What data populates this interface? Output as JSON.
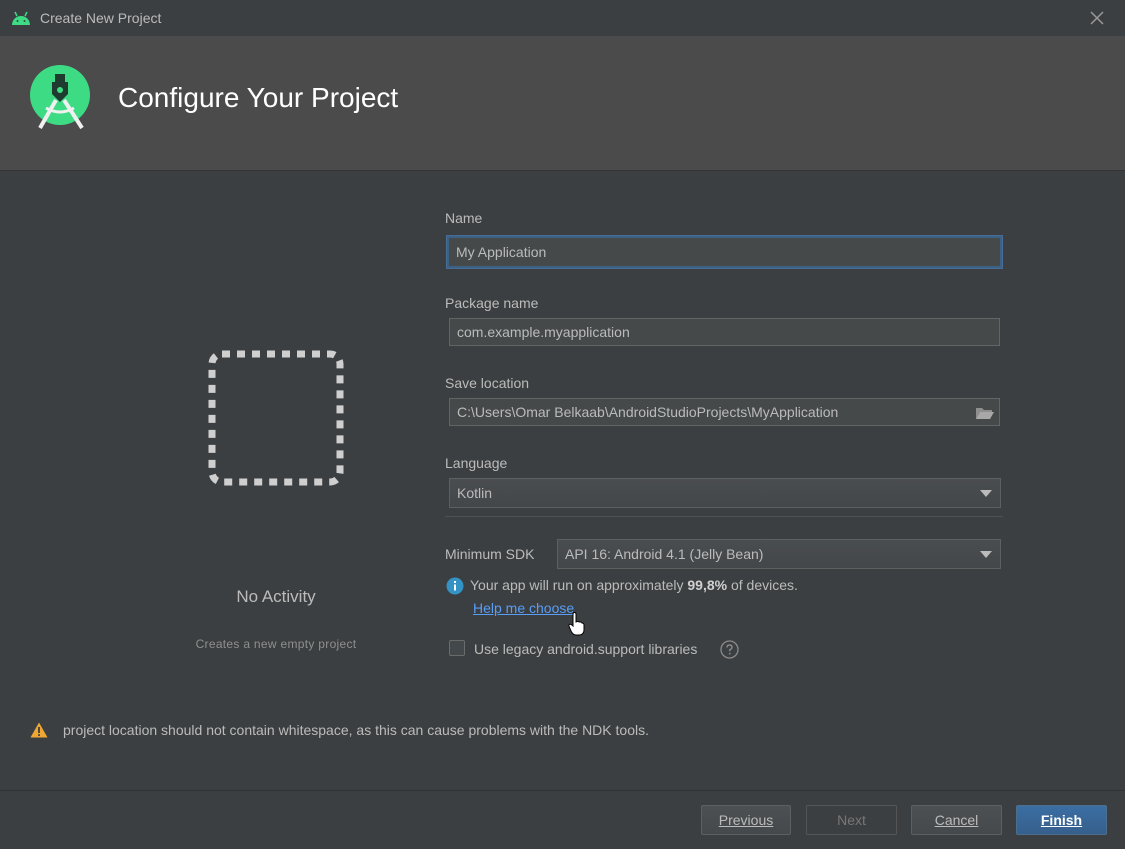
{
  "window": {
    "title": "Create New Project",
    "app_icon": "android-head-icon",
    "close_icon": "close-icon"
  },
  "header": {
    "title": "Configure Your Project",
    "logo_icon": "android-studio-logo"
  },
  "template": {
    "name": "No Activity",
    "description": "Creates a new empty project"
  },
  "form": {
    "name_label": "Name",
    "name_value": "My Application",
    "package_label": "Package name",
    "package_value": "com.example.myapplication",
    "save_label": "Save location",
    "save_value": "C:\\Users\\Omar Belkaab\\AndroidStudioProjects\\MyApplication",
    "language_label": "Language",
    "language_value": "Kotlin",
    "min_sdk_label": "Minimum SDK",
    "min_sdk_value": "API 16: Android 4.1 (Jelly Bean)",
    "info_prefix": "Your app will run on approximately ",
    "info_percent": "99,8%",
    "info_suffix": " of devices.",
    "help_link": "Help me choose",
    "legacy_label": "Use legacy android.support libraries",
    "legacy_checked": false
  },
  "warning": {
    "text": "project location should not contain whitespace, as this can cause problems with the NDK tools."
  },
  "buttons": {
    "previous": "Previous",
    "next": "Next",
    "cancel": "Cancel",
    "finish": "Finish"
  },
  "colors": {
    "background": "#3c3f41",
    "header": "#4b4b4b",
    "accent": "#3d6185",
    "link": "#589df6",
    "android_green": "#3ddc84",
    "warning": "#f0a732"
  }
}
